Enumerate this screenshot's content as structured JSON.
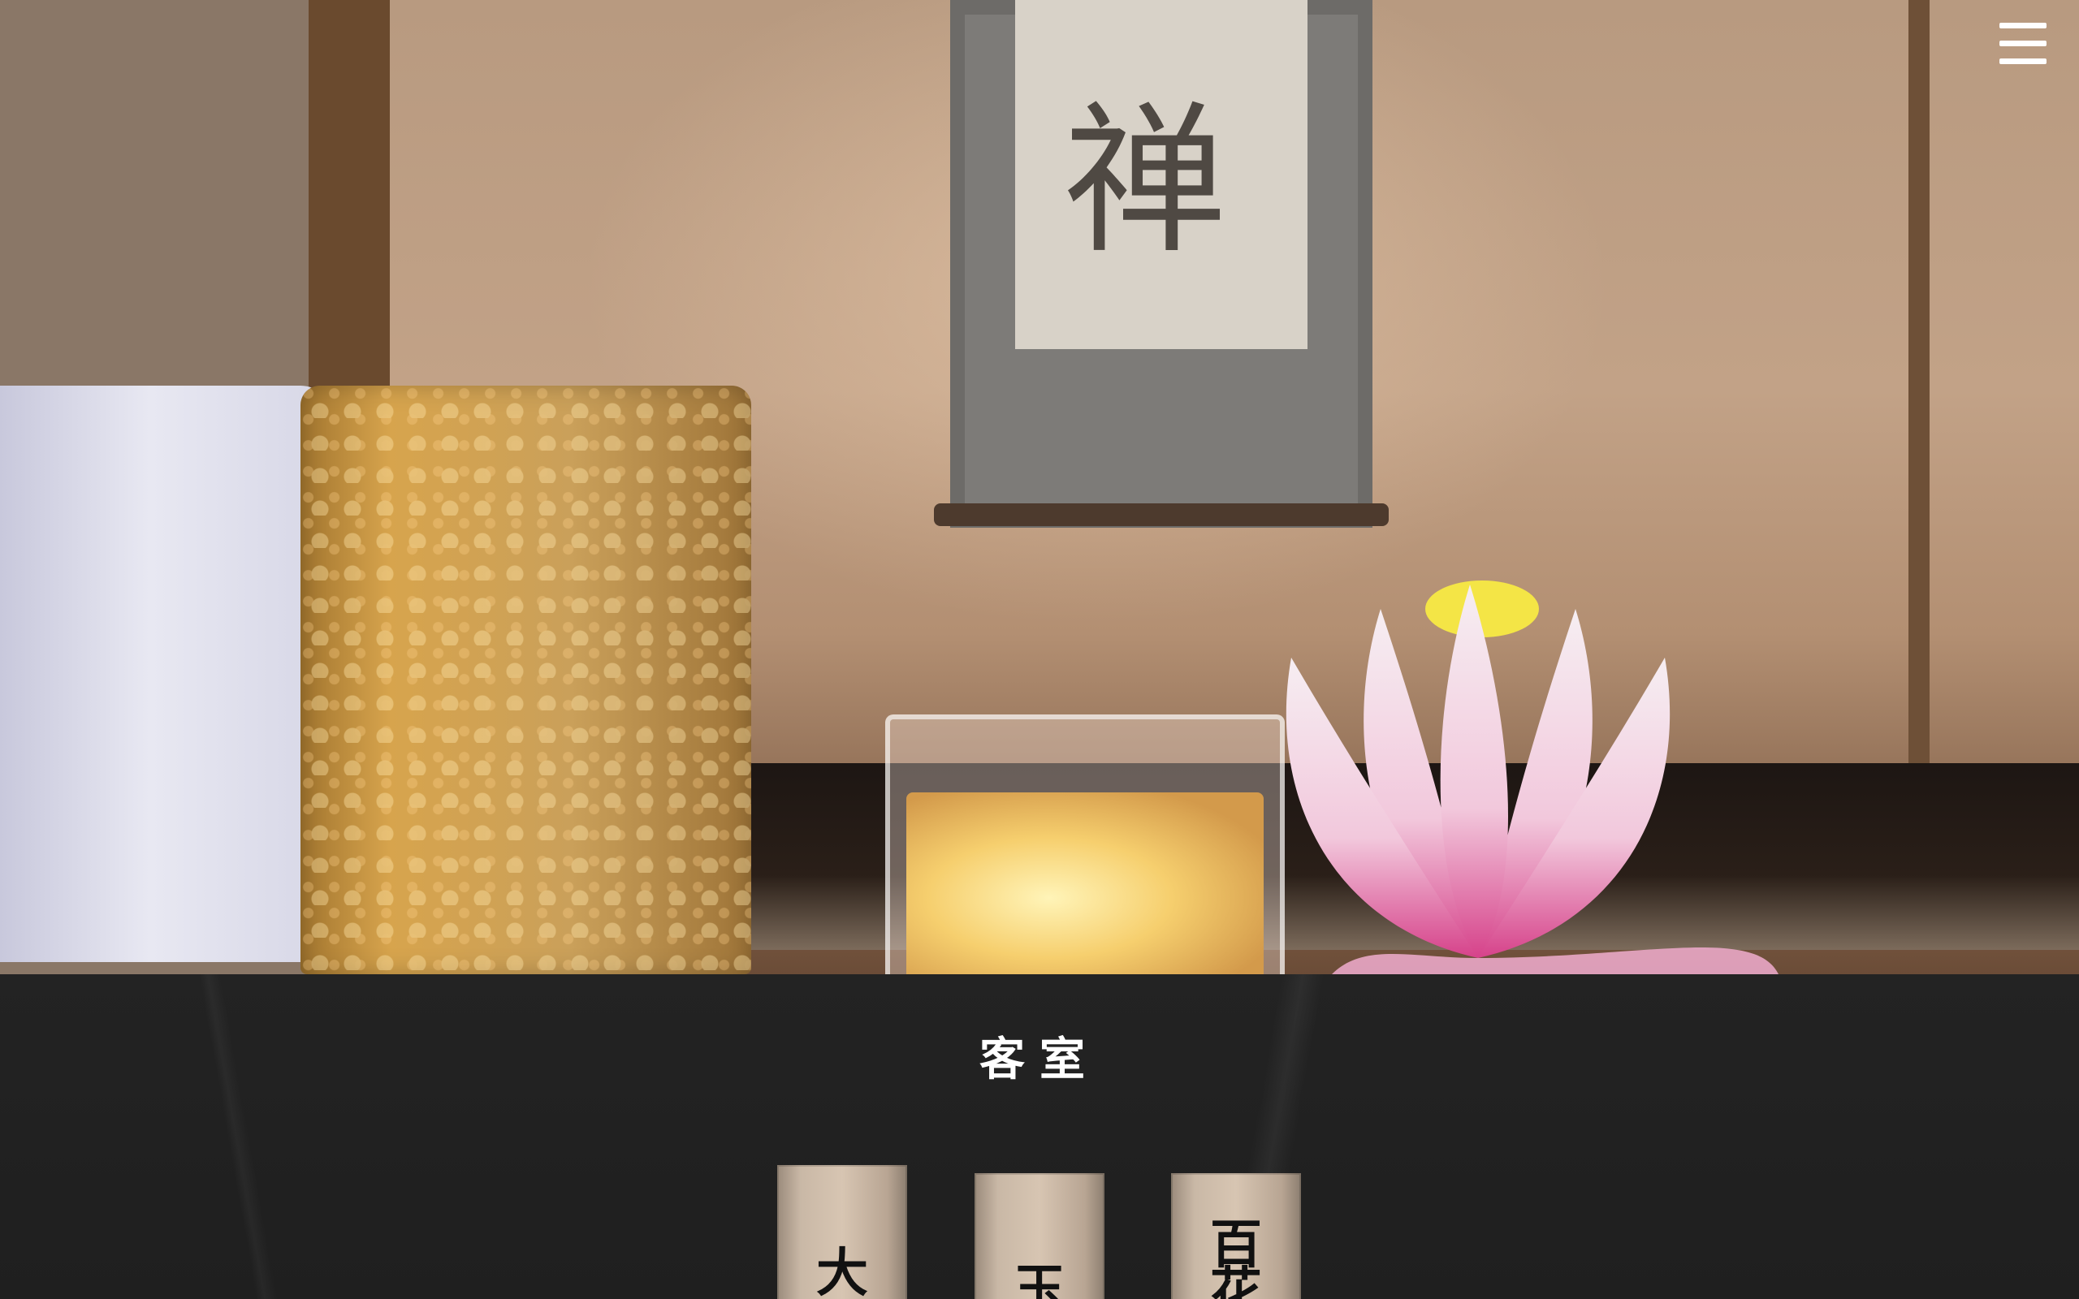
{
  "header": {
    "menu_icon": "hamburger-menu-icon"
  },
  "hero": {
    "scroll_glyph": "禅"
  },
  "rooms_section": {
    "title": "客室",
    "plaques": [
      {
        "label": "大"
      },
      {
        "label": "玉"
      },
      {
        "label": "百花"
      }
    ]
  },
  "colors": {
    "section_background": "#222222",
    "title_text": "#ffffff",
    "plaque_wood": "#d7c5b2"
  }
}
